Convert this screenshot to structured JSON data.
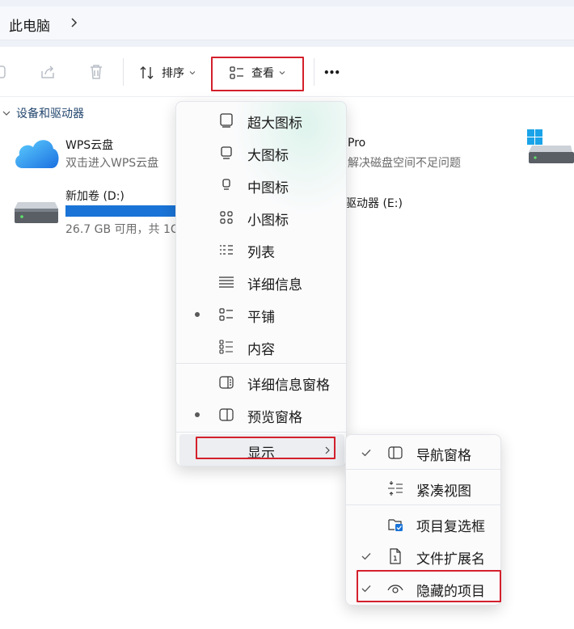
{
  "address": {
    "crumb": "此电脑"
  },
  "toolbar": {
    "sort_label": "排序",
    "view_label": "查看",
    "more_label": "•••"
  },
  "group": {
    "label": "设备和驱动器"
  },
  "drives": [
    {
      "name": "WPS云盘",
      "subtitle": "双击进入WPS云盘"
    },
    {
      "name": "新加卷 (D:)",
      "subtitle": "26.7 GB 可用，共 1C"
    },
    {
      "name_partial": "Pro",
      "subtitle_partial": "解决磁盘空间不足问题"
    },
    {
      "name_partial": "驱动器 (E:)"
    }
  ],
  "view_menu": {
    "items": [
      {
        "label": "超大图标",
        "icon": "extra-large-icons-icon",
        "selected": false
      },
      {
        "label": "大图标",
        "icon": "large-icons-icon",
        "selected": false
      },
      {
        "label": "中图标",
        "icon": "medium-icons-icon",
        "selected": false
      },
      {
        "label": "小图标",
        "icon": "small-icons-icon",
        "selected": false
      },
      {
        "label": "列表",
        "icon": "list-icon",
        "selected": false
      },
      {
        "label": "详细信息",
        "icon": "details-icon",
        "selected": false
      },
      {
        "label": "平铺",
        "icon": "tiles-icon",
        "selected": true
      },
      {
        "label": "内容",
        "icon": "content-icon",
        "selected": false
      }
    ],
    "pane_items": [
      {
        "label": "详细信息窗格",
        "icon": "details-pane-icon",
        "selected": false
      },
      {
        "label": "预览窗格",
        "icon": "preview-pane-icon",
        "selected": true
      }
    ],
    "show_label": "显示"
  },
  "show_submenu": {
    "items": [
      {
        "label": "导航窗格",
        "icon": "navigation-pane-icon",
        "checked": true
      },
      {
        "label": "紧凑视图",
        "icon": "compact-view-icon",
        "checked": false
      },
      {
        "label": "项目复选框",
        "icon": "item-checkbox-icon",
        "checked": false
      },
      {
        "label": "文件扩展名",
        "icon": "file-extension-icon",
        "checked": true
      },
      {
        "label": "隐藏的项目",
        "icon": "eye-icon",
        "checked": true
      }
    ]
  },
  "colors": {
    "accent": "#1a73d6",
    "highlight_box": "#d4202c",
    "group_label": "#22466e"
  }
}
